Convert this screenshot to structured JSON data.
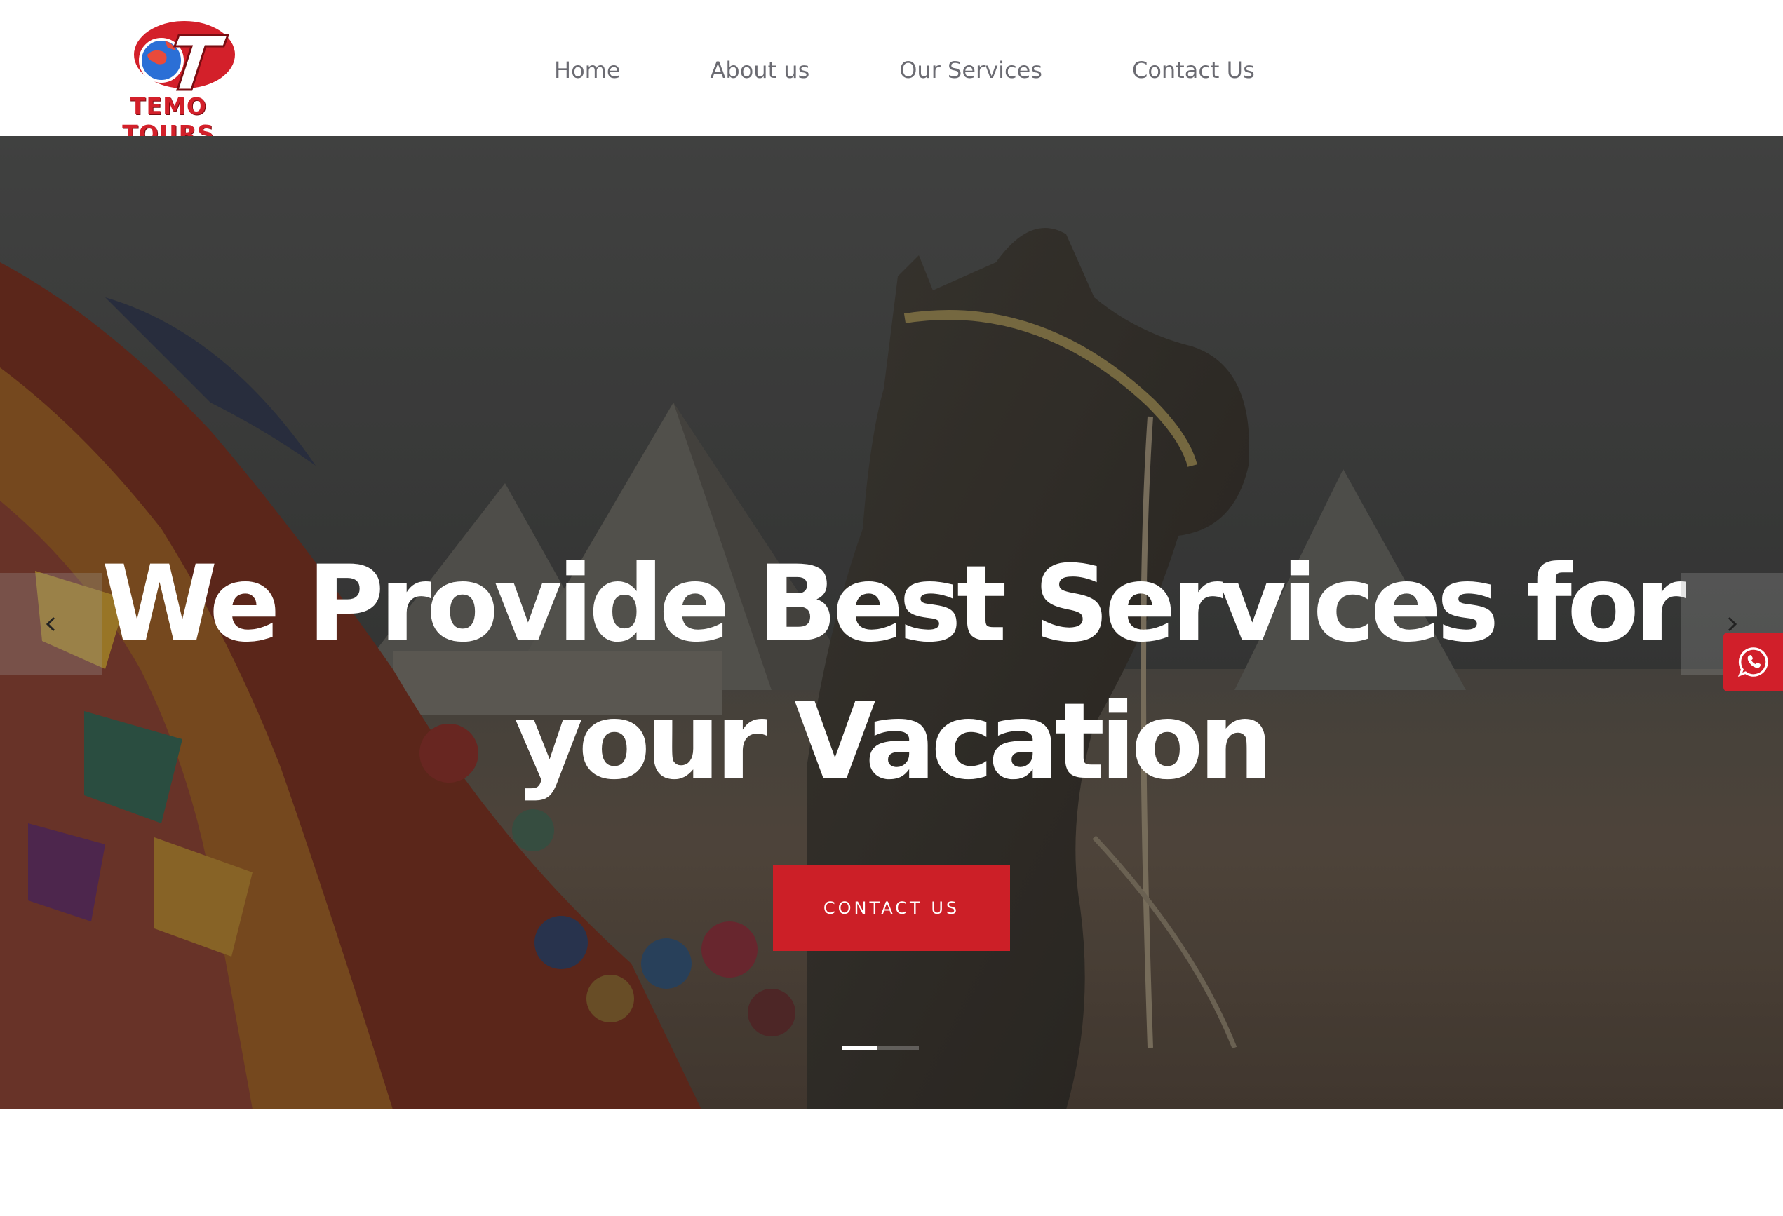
{
  "brand": {
    "name": "TEMO TOURS",
    "logo_icon": "globe-t-logo-icon"
  },
  "nav": {
    "items": [
      {
        "label": "Home"
      },
      {
        "label": "About us"
      },
      {
        "label": "Our Services"
      },
      {
        "label": "Contact Us"
      }
    ]
  },
  "hero": {
    "title_line1": "We Provide Best Services for",
    "title_line2": "your Vacation",
    "cta_label": "CONTACT US",
    "background_icon": "camel-pyramids-photo",
    "slides_total": 3,
    "active_slide": 1,
    "prev_icon": "chevron-left-icon",
    "next_icon": "chevron-right-icon"
  },
  "floating": {
    "whatsapp_icon": "whatsapp-icon"
  },
  "colors": {
    "accent": "#cc1f27",
    "nav_text": "#6b6b72",
    "hero_text": "#ffffff"
  }
}
